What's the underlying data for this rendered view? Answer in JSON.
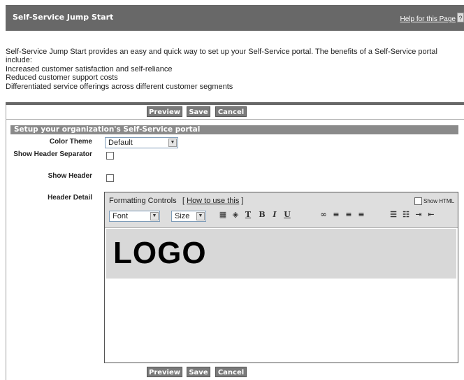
{
  "header": {
    "title": "Self-Service Jump Start",
    "help_link": "Help for this Page",
    "help_icon": "?"
  },
  "intro": {
    "line1": "Self-Service Jump Start provides an easy and quick way to set up your Self-Service portal. The benefits of a Self-Service portal",
    "line2": "include:",
    "benefits": [
      "Increased customer satisfaction and self-reliance",
      "Reduced customer support costs",
      "Differentiated service offerings across different customer segments"
    ]
  },
  "buttons": {
    "preview": "Preview",
    "save": "Save",
    "cancel": "Cancel"
  },
  "section": {
    "title": "Setup your organization's Self-Service portal"
  },
  "form": {
    "color_theme_label": "Color Theme",
    "color_theme_value": "Default",
    "show_header_separator_label": "Show Header Separator",
    "show_header_label": "Show Header",
    "header_detail_label": "Header Detail"
  },
  "editor": {
    "formatting_controls": "Formatting Controls",
    "how_to_use": "How to use this",
    "show_html": "Show HTML",
    "font_select": "Font",
    "size_select": "Size",
    "logo_text": "LOGO",
    "toolbar_icons": [
      "table-icon",
      "background-color-icon",
      "text-color-icon",
      "bold-icon",
      "italic-icon",
      "underline-icon",
      "link-icon",
      "align-left-icon",
      "align-center-icon",
      "align-right-icon",
      "bullet-list-icon",
      "numbered-list-icon",
      "indent-icon",
      "outdent-icon"
    ]
  },
  "colors": {
    "header_bg": "#686868",
    "section_bg": "#8a8a8a",
    "button_bg": "#7a7a7a",
    "logo_area_bg": "#d8d8d8"
  }
}
